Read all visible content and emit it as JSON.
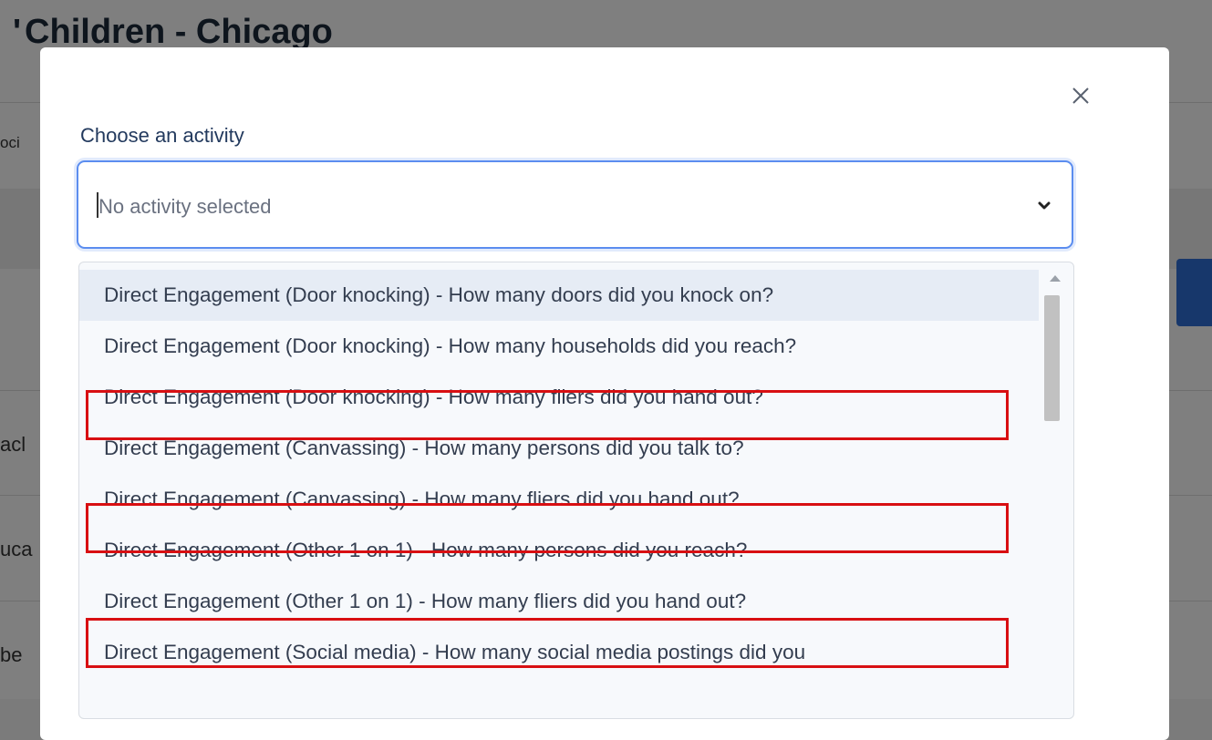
{
  "background_page": {
    "title": "Children - Chicago",
    "fragments": [
      "oci",
      "acl",
      "uca",
      "be"
    ]
  },
  "modal": {
    "close_icon": "×",
    "label": "Choose an activity",
    "select": {
      "placeholder": "No activity selected",
      "chevron_icon": "chevron-down-icon"
    },
    "options": [
      {
        "label": "Direct Engagement (Door knocking) - How many doors did you knock on?",
        "active": true,
        "highlighted": false
      },
      {
        "label": "Direct Engagement (Door knocking) - How many households did you reach?",
        "active": false,
        "highlighted": false
      },
      {
        "label": "Direct Engagement (Door knocking) - How many fliers did you hand out?",
        "active": false,
        "highlighted": true
      },
      {
        "label": "Direct Engagement (Canvassing) - How many persons did you talk to?",
        "active": false,
        "highlighted": false
      },
      {
        "label": "Direct Engagement (Canvassing) - How many fliers did you hand out?",
        "active": false,
        "highlighted": true
      },
      {
        "label": "Direct Engagement (Other 1 on 1) - How many persons did you reach?",
        "active": false,
        "highlighted": false
      },
      {
        "label": "Direct Engagement (Other 1 on 1) - How many fliers did you hand out?",
        "active": false,
        "highlighted": true
      },
      {
        "label": "Direct Engagement (Social media) - How many social media postings did you",
        "active": false,
        "highlighted": false
      }
    ]
  },
  "colors": {
    "highlight": "#d80f12",
    "focus_border": "#5b8def",
    "active_option": "#e6ecf5"
  }
}
